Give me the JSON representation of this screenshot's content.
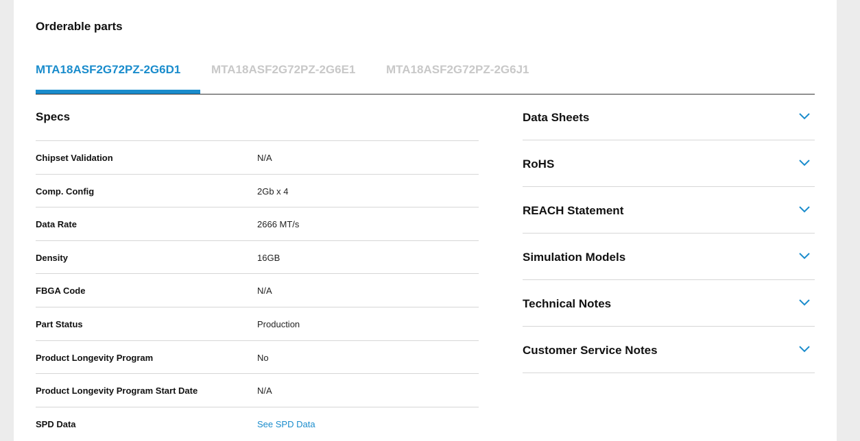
{
  "section": {
    "heading": "Orderable parts"
  },
  "tabs": [
    {
      "label": "MTA18ASF2G72PZ-2G6D1",
      "active": true
    },
    {
      "label": "MTA18ASF2G72PZ-2G6E1",
      "active": false
    },
    {
      "label": "MTA18ASF2G72PZ-2G6J1",
      "active": false
    }
  ],
  "specs": {
    "title": "Specs",
    "rows": [
      {
        "label": "Chipset Validation",
        "value": "N/A"
      },
      {
        "label": "Comp. Config",
        "value": "2Gb x 4"
      },
      {
        "label": "Data Rate",
        "value": "2666 MT/s"
      },
      {
        "label": "Density",
        "value": "16GB"
      },
      {
        "label": "FBGA Code",
        "value": "N/A"
      },
      {
        "label": "Part Status",
        "value": "Production"
      },
      {
        "label": "Product Longevity Program",
        "value": "No"
      },
      {
        "label": "Product Longevity Program Start Date",
        "value": "N/A"
      },
      {
        "label": "SPD Data",
        "value": "See SPD Data"
      }
    ]
  },
  "accordion": [
    {
      "label": "Data Sheets",
      "icon": "chevron-down-icon"
    },
    {
      "label": "RoHS",
      "icon": "chevron-down-icon"
    },
    {
      "label": "REACH Statement",
      "icon": "chevron-down-icon"
    },
    {
      "label": "Simulation Models",
      "icon": "chevron-down-icon"
    },
    {
      "label": "Technical Notes",
      "icon": "chevron-down-icon"
    },
    {
      "label": "Customer Service Notes",
      "icon": "chevron-down-icon"
    }
  ],
  "colors": {
    "accent": "#1a8ccc",
    "inactive_tab": "#c8c8c8",
    "page_bg": "#ececec"
  }
}
